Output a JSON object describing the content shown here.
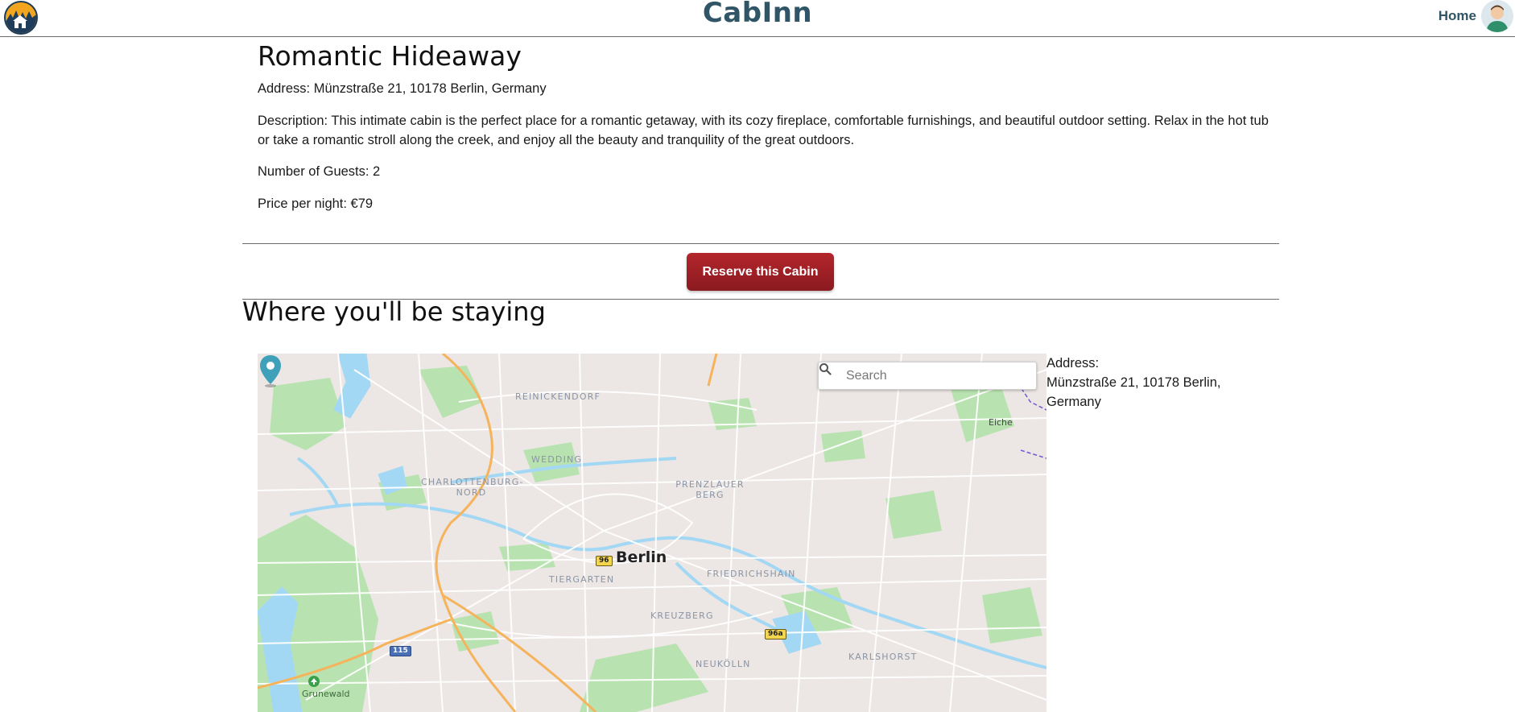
{
  "header": {
    "brand": "CabInn",
    "home_label": "Home"
  },
  "cabin": {
    "title": "Romantic Hideaway",
    "address": "Address: Münzstraße 21, 10178 Berlin, Germany",
    "description": "Description: This intimate cabin is the perfect place for a romantic getaway, with its cozy fireplace, comfortable furnishings, and beautiful outdoor setting. Relax in the hot tub or take a romantic stroll along the creek, and enjoy all the beauty and tranquility of the great outdoors.",
    "guests": "Number of Guests: 2",
    "price": "Price per night: €79"
  },
  "reserve_button": "Reserve this Cabin",
  "location": {
    "heading": "Where you'll be staying",
    "address_label": "Address:",
    "address_value": "Münzstraße 21, 10178 Berlin, Germany"
  },
  "map": {
    "search_placeholder": "Search",
    "city": "Berlin",
    "districts": {
      "reinickendorf": "REINICKENDORF",
      "wedding": "WEDDING",
      "charlottenburg": "CHARLOTTENBURG-\nNORD",
      "prenzlauer": "PRENZLAUER\nBERG",
      "tiergarten": "TIERGARTEN",
      "friedrichshain": "FRIEDRICHSHAIN",
      "kreuzberg": "KREUZBERG",
      "neukolln": "NEUKÖLLN",
      "karlshorst": "KARLSHORST"
    },
    "places": {
      "grunewald": "Grunewald",
      "eiche": "Eiche"
    },
    "shields": {
      "s96": "96",
      "s96a": "96a",
      "s115": "115"
    },
    "colors": {
      "land": "#ece6e4",
      "water": "#a3d8f5",
      "park": "#b8e3b0",
      "highway": "#f5b35c",
      "pin": "#3ea1b9"
    }
  },
  "icons": {
    "logo": "cabin-logo-icon",
    "avatar": "user-avatar-icon",
    "search": "search-icon",
    "pin": "map-pin-icon"
  }
}
